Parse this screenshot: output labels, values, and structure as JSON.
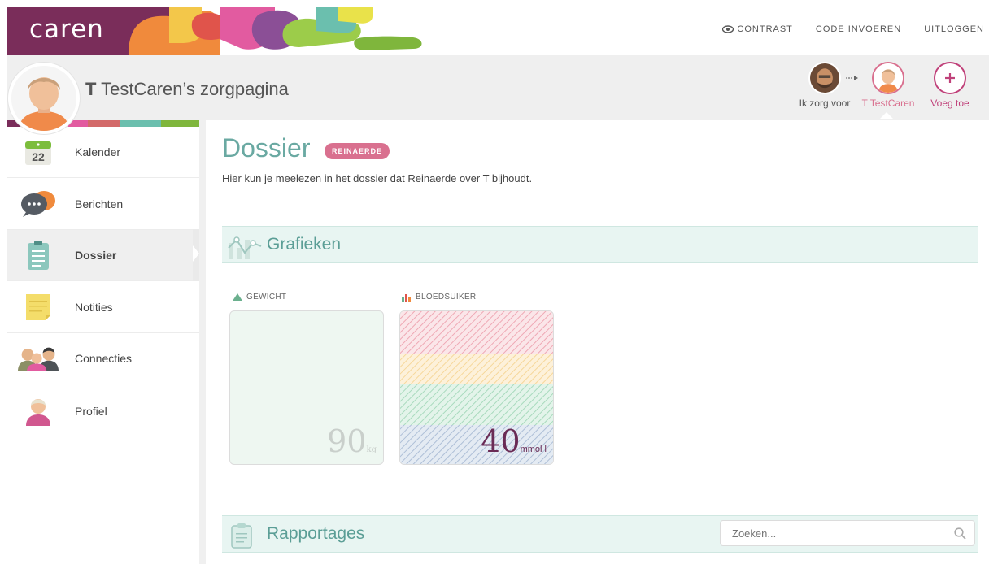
{
  "topbar": {
    "logo": "caren",
    "links": {
      "contrast": "CONTRAST",
      "code": "CODE INVOEREN",
      "logout": "UITLOGGEN"
    }
  },
  "header": {
    "owner_initial": "T",
    "owner_rest": "TestCaren’s zorgpagina",
    "switch": {
      "me_label": "Ik zorg voor",
      "current_label": "T TestCaren",
      "add_label": "Voeg toe"
    }
  },
  "sidebar": {
    "calendar_day": "22",
    "items": [
      {
        "label": "Kalender"
      },
      {
        "label": "Berichten"
      },
      {
        "label": "Dossier"
      },
      {
        "label": "Notities"
      },
      {
        "label": "Connecties"
      },
      {
        "label": "Profiel"
      }
    ]
  },
  "main": {
    "title": "Dossier",
    "badge": "REINAERDE",
    "intro": "Hier kun je meelezen in het dossier dat Reinaerde over T bijhoudt.",
    "graphs_title": "Grafieken",
    "weight": {
      "label": "GEWICHT",
      "value": "90",
      "unit": "kg"
    },
    "sugar": {
      "label": "BLOEDSUIKER",
      "value": "40",
      "unit": "mmol l"
    },
    "reports_title": "Rapportages",
    "search_placeholder": "Zoeken..."
  },
  "colors": {
    "teal": "#5b9e96",
    "pink": "#d9708f",
    "section_bg": "#e8f5f2"
  }
}
